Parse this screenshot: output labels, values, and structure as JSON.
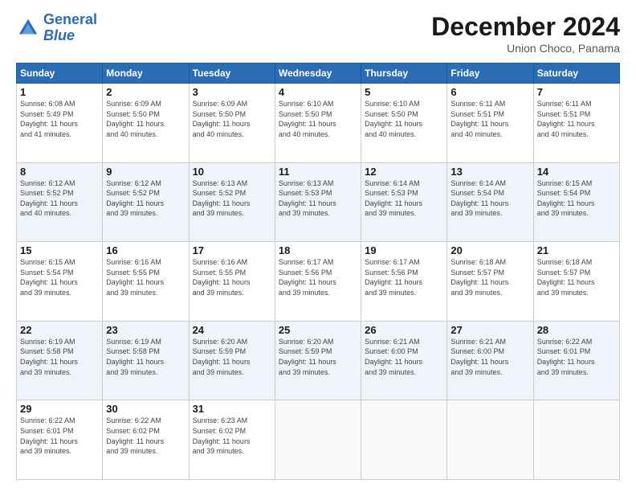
{
  "header": {
    "logo_line1": "General",
    "logo_line2": "Blue",
    "title": "December 2024",
    "subtitle": "Union Choco, Panama"
  },
  "weekdays": [
    "Sunday",
    "Monday",
    "Tuesday",
    "Wednesday",
    "Thursday",
    "Friday",
    "Saturday"
  ],
  "weeks": [
    [
      {
        "day": "1",
        "info": "Sunrise: 6:08 AM\nSunset: 5:49 PM\nDaylight: 11 hours\nand 41 minutes."
      },
      {
        "day": "2",
        "info": "Sunrise: 6:09 AM\nSunset: 5:50 PM\nDaylight: 11 hours\nand 40 minutes."
      },
      {
        "day": "3",
        "info": "Sunrise: 6:09 AM\nSunset: 5:50 PM\nDaylight: 11 hours\nand 40 minutes."
      },
      {
        "day": "4",
        "info": "Sunrise: 6:10 AM\nSunset: 5:50 PM\nDaylight: 11 hours\nand 40 minutes."
      },
      {
        "day": "5",
        "info": "Sunrise: 6:10 AM\nSunset: 5:50 PM\nDaylight: 11 hours\nand 40 minutes."
      },
      {
        "day": "6",
        "info": "Sunrise: 6:11 AM\nSunset: 5:51 PM\nDaylight: 11 hours\nand 40 minutes."
      },
      {
        "day": "7",
        "info": "Sunrise: 6:11 AM\nSunset: 5:51 PM\nDaylight: 11 hours\nand 40 minutes."
      }
    ],
    [
      {
        "day": "8",
        "info": "Sunrise: 6:12 AM\nSunset: 5:52 PM\nDaylight: 11 hours\nand 40 minutes."
      },
      {
        "day": "9",
        "info": "Sunrise: 6:12 AM\nSunset: 5:52 PM\nDaylight: 11 hours\nand 39 minutes."
      },
      {
        "day": "10",
        "info": "Sunrise: 6:13 AM\nSunset: 5:52 PM\nDaylight: 11 hours\nand 39 minutes."
      },
      {
        "day": "11",
        "info": "Sunrise: 6:13 AM\nSunset: 5:53 PM\nDaylight: 11 hours\nand 39 minutes."
      },
      {
        "day": "12",
        "info": "Sunrise: 6:14 AM\nSunset: 5:53 PM\nDaylight: 11 hours\nand 39 minutes."
      },
      {
        "day": "13",
        "info": "Sunrise: 6:14 AM\nSunset: 5:54 PM\nDaylight: 11 hours\nand 39 minutes."
      },
      {
        "day": "14",
        "info": "Sunrise: 6:15 AM\nSunset: 5:54 PM\nDaylight: 11 hours\nand 39 minutes."
      }
    ],
    [
      {
        "day": "15",
        "info": "Sunrise: 6:15 AM\nSunset: 5:54 PM\nDaylight: 11 hours\nand 39 minutes."
      },
      {
        "day": "16",
        "info": "Sunrise: 6:16 AM\nSunset: 5:55 PM\nDaylight: 11 hours\nand 39 minutes."
      },
      {
        "day": "17",
        "info": "Sunrise: 6:16 AM\nSunset: 5:55 PM\nDaylight: 11 hours\nand 39 minutes."
      },
      {
        "day": "18",
        "info": "Sunrise: 6:17 AM\nSunset: 5:56 PM\nDaylight: 11 hours\nand 39 minutes."
      },
      {
        "day": "19",
        "info": "Sunrise: 6:17 AM\nSunset: 5:56 PM\nDaylight: 11 hours\nand 39 minutes."
      },
      {
        "day": "20",
        "info": "Sunrise: 6:18 AM\nSunset: 5:57 PM\nDaylight: 11 hours\nand 39 minutes."
      },
      {
        "day": "21",
        "info": "Sunrise: 6:18 AM\nSunset: 5:57 PM\nDaylight: 11 hours\nand 39 minutes."
      }
    ],
    [
      {
        "day": "22",
        "info": "Sunrise: 6:19 AM\nSunset: 5:58 PM\nDaylight: 11 hours\nand 39 minutes."
      },
      {
        "day": "23",
        "info": "Sunrise: 6:19 AM\nSunset: 5:58 PM\nDaylight: 11 hours\nand 39 minutes."
      },
      {
        "day": "24",
        "info": "Sunrise: 6:20 AM\nSunset: 5:59 PM\nDaylight: 11 hours\nand 39 minutes."
      },
      {
        "day": "25",
        "info": "Sunrise: 6:20 AM\nSunset: 5:59 PM\nDaylight: 11 hours\nand 39 minutes."
      },
      {
        "day": "26",
        "info": "Sunrise: 6:21 AM\nSunset: 6:00 PM\nDaylight: 11 hours\nand 39 minutes."
      },
      {
        "day": "27",
        "info": "Sunrise: 6:21 AM\nSunset: 6:00 PM\nDaylight: 11 hours\nand 39 minutes."
      },
      {
        "day": "28",
        "info": "Sunrise: 6:22 AM\nSunset: 6:01 PM\nDaylight: 11 hours\nand 39 minutes."
      }
    ],
    [
      {
        "day": "29",
        "info": "Sunrise: 6:22 AM\nSunset: 6:01 PM\nDaylight: 11 hours\nand 39 minutes."
      },
      {
        "day": "30",
        "info": "Sunrise: 6:22 AM\nSunset: 6:02 PM\nDaylight: 11 hours\nand 39 minutes."
      },
      {
        "day": "31",
        "info": "Sunrise: 6:23 AM\nSunset: 6:02 PM\nDaylight: 11 hours\nand 39 minutes."
      },
      {
        "day": "",
        "info": ""
      },
      {
        "day": "",
        "info": ""
      },
      {
        "day": "",
        "info": ""
      },
      {
        "day": "",
        "info": ""
      }
    ]
  ]
}
